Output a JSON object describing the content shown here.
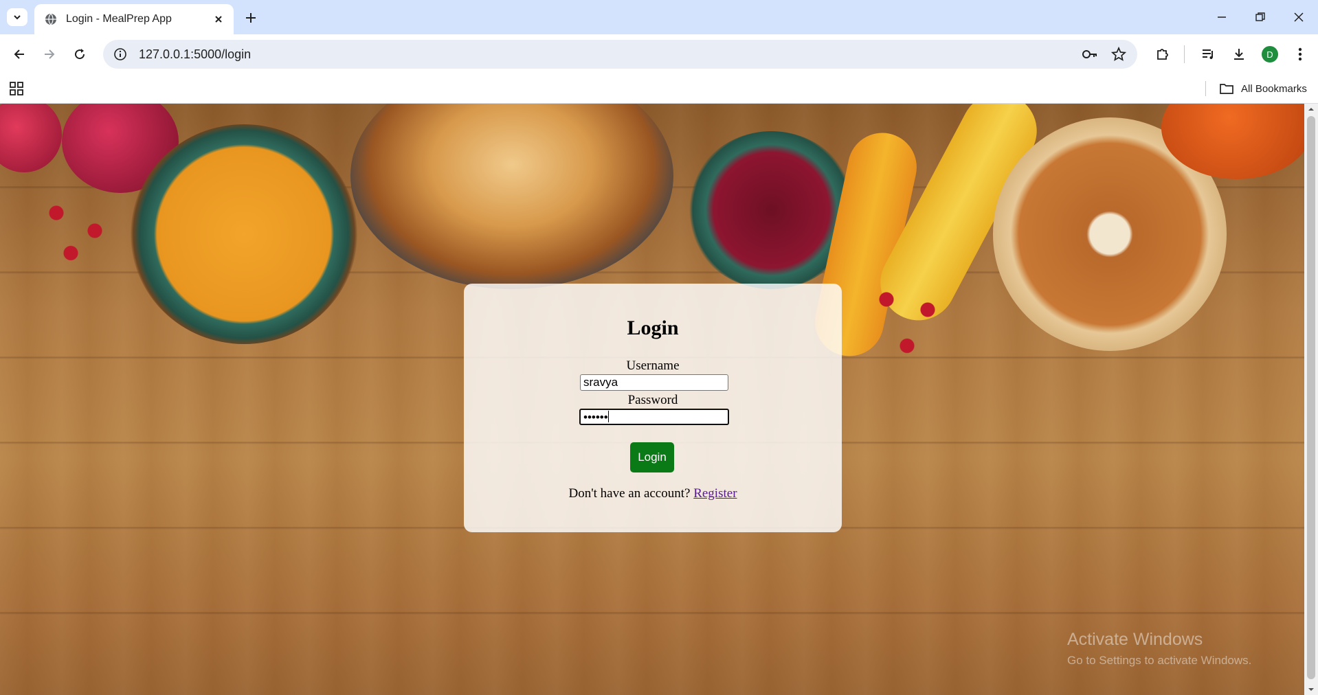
{
  "browser": {
    "tab_title": "Login - MealPrep App",
    "url": "127.0.0.1:5000/login",
    "profile_initial": "D",
    "bookmarks_label": "All Bookmarks"
  },
  "login": {
    "heading": "Login",
    "username_label": "Username",
    "username_value": "sravya",
    "password_label": "Password",
    "password_mask": "••••••",
    "submit_label": "Login",
    "footer_text": "Don't have an account?",
    "register_link": "Register"
  },
  "watermark": {
    "line1": "Activate Windows",
    "line2": "Go to Settings to activate Windows."
  },
  "colors": {
    "tabbar_bg": "#d3e3fd",
    "login_button": "#0a7a16",
    "link": "#551a8b",
    "profile_avatar": "#1e8e3e"
  }
}
